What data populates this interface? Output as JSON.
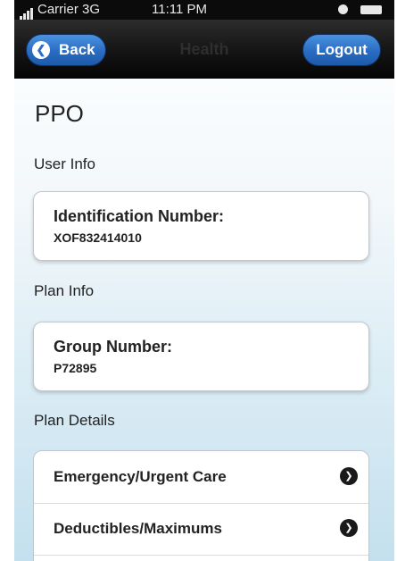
{
  "status_bar": {
    "carrier": "Carrier 3G",
    "time": "11:11 PM"
  },
  "navbar": {
    "title": "Health",
    "back_label": "Back",
    "logout_label": "Logout"
  },
  "page": {
    "title": "PPO"
  },
  "sections": {
    "user_info": {
      "label": "User Info",
      "field_label": "Identification Number:",
      "field_value": "XOF832414010"
    },
    "plan_info": {
      "label": "Plan Info",
      "field_label": "Group Number:",
      "field_value": "P72895"
    },
    "plan_details": {
      "label": "Plan Details",
      "items": [
        {
          "label": "Emergency/Urgent Care"
        },
        {
          "label": "Deductibles/Maximums"
        }
      ]
    }
  },
  "icons": {
    "back": "chevron-left-icon",
    "row_arrow": "chevron-right-circle-icon"
  },
  "colors": {
    "nav_button": "#2a6cc2",
    "navbar": "#141414",
    "background_gradient_end": "#c4e0ee"
  }
}
